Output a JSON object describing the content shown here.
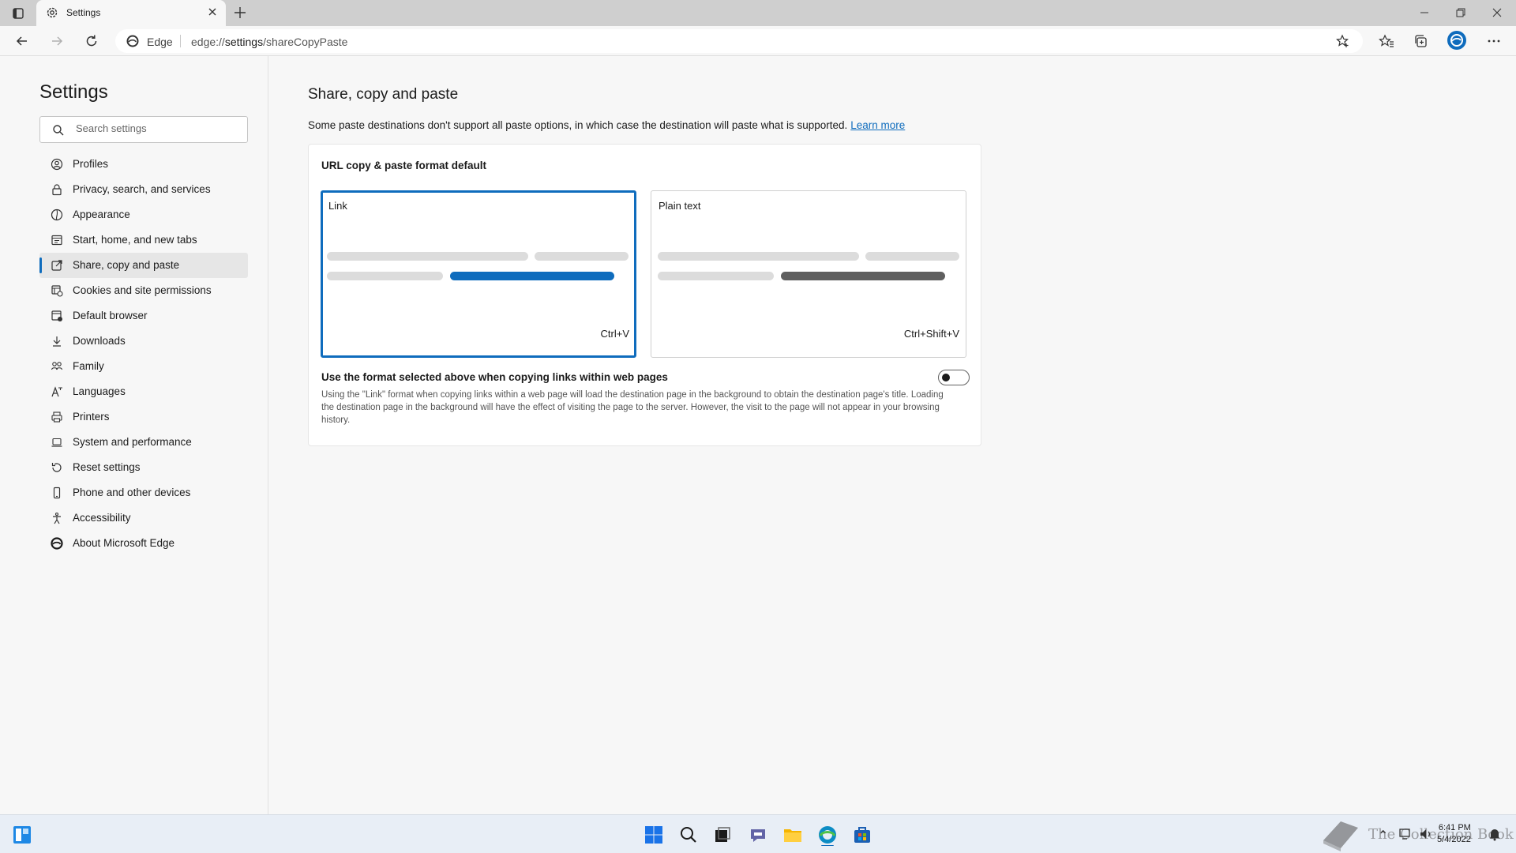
{
  "browser": {
    "tab_title": "Settings",
    "address_label": "Edge",
    "url_prefix": "edge://",
    "url_bold": "settings",
    "url_rest": "/shareCopyPaste"
  },
  "sidebar": {
    "title": "Settings",
    "search_placeholder": "Search settings",
    "items": [
      {
        "label": "Profiles",
        "icon": "profile-icon"
      },
      {
        "label": "Privacy, search, and services",
        "icon": "lock-icon"
      },
      {
        "label": "Appearance",
        "icon": "appearance-icon"
      },
      {
        "label": "Start, home, and new tabs",
        "icon": "home-tabs-icon"
      },
      {
        "label": "Share, copy and paste",
        "icon": "share-icon",
        "active": true
      },
      {
        "label": "Cookies and site permissions",
        "icon": "cookies-icon"
      },
      {
        "label": "Default browser",
        "icon": "browser-icon"
      },
      {
        "label": "Downloads",
        "icon": "download-icon"
      },
      {
        "label": "Family",
        "icon": "family-icon"
      },
      {
        "label": "Languages",
        "icon": "languages-icon"
      },
      {
        "label": "Printers",
        "icon": "printer-icon"
      },
      {
        "label": "System and performance",
        "icon": "laptop-icon"
      },
      {
        "label": "Reset settings",
        "icon": "reset-icon"
      },
      {
        "label": "Phone and other devices",
        "icon": "phone-icon"
      },
      {
        "label": "Accessibility",
        "icon": "accessibility-icon"
      },
      {
        "label": "About Microsoft Edge",
        "icon": "edge-logo-icon"
      }
    ]
  },
  "main": {
    "title": "Share, copy and paste",
    "description": "Some paste destinations don't support all paste options, in which case the destination will paste what is supported.",
    "learn_more": "Learn more",
    "card_title": "URL copy & paste format default",
    "option_link": {
      "label": "Link",
      "shortcut": "Ctrl+V",
      "selected": true
    },
    "option_plain": {
      "label": "Plain text",
      "shortcut": "Ctrl+Shift+V",
      "selected": false
    },
    "toggle_title": "Use the format selected above when copying links within web pages",
    "toggle_desc": "Using the \"Link\" format when copying links within a web page will load the destination page in the background to obtain the destination page's title. Loading the destination page in the background will have the effect of visiting the page to the server. However, the visit to the page will not appear in your browsing history.",
    "toggle_on": false
  },
  "colors": {
    "accent": "#0f6cbd",
    "plain_bar": "#5f5f5f",
    "placeholder_bar": "#dcdcdc"
  },
  "taskbar": {
    "time": "6:41 PM",
    "date": "5/4/2022",
    "watermark": "The Collection Book"
  }
}
